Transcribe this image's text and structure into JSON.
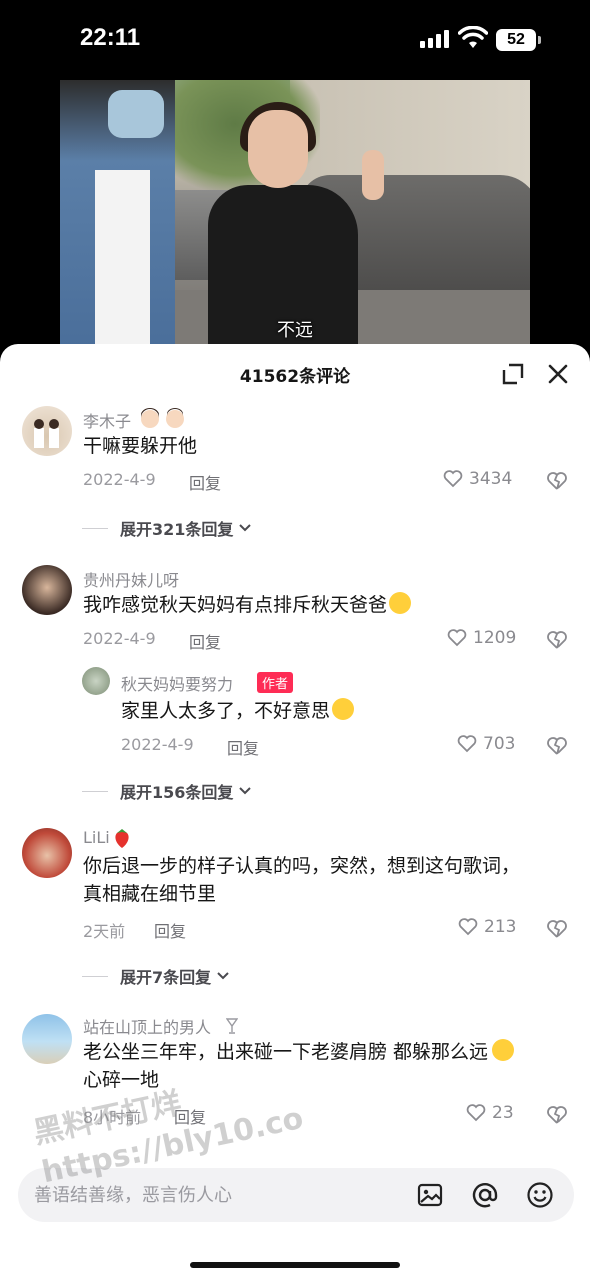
{
  "status": {
    "time": "22:11",
    "battery": "52"
  },
  "video": {
    "subtitle": "不远"
  },
  "sheet": {
    "title": "41562条评论"
  },
  "comments": [
    {
      "author": "李木子",
      "text": "干嘛要躲开他",
      "date": "2022-4-9",
      "reply_label": "回复",
      "likes": "3434",
      "expand": "展开321条回复"
    },
    {
      "author": "贵州丹妹儿呀",
      "text": "我咋感觉秋天妈妈有点排斥秋天爸爸",
      "date": "2022-4-9",
      "reply_label": "回复",
      "likes": "1209",
      "reply": {
        "author": "秋天妈妈要努力",
        "tag": "作者",
        "text": "家里人太多了，不好意思",
        "date": "2022-4-9",
        "reply_label": "回复",
        "likes": "703"
      },
      "expand": "展开156条回复"
    },
    {
      "author": "LiLi",
      "text_lines": [
        "你后退一步的样子认真的吗，突然，想到这句歌词，",
        "真相藏在细节里"
      ],
      "date": "2天前",
      "reply_label": "回复",
      "likes": "213",
      "expand": "展开7条回复"
    },
    {
      "author": "站在山顶上的男人",
      "text_lines": [
        "老公坐三年牢，出来碰一下老婆肩膀 都躲那么远",
        "心碎一地"
      ],
      "date": "8小时前",
      "reply_label": "回复",
      "likes": "23"
    }
  ],
  "input": {
    "placeholder": "善语结善缘，恶言伤人心"
  },
  "watermark": {
    "line1": "黑料不打烊",
    "line2": "https://bly10.co"
  },
  "colors": {
    "author_tag": "#fe2c55",
    "sheet_bg": "#ffffff",
    "page_bg": "#000000"
  }
}
